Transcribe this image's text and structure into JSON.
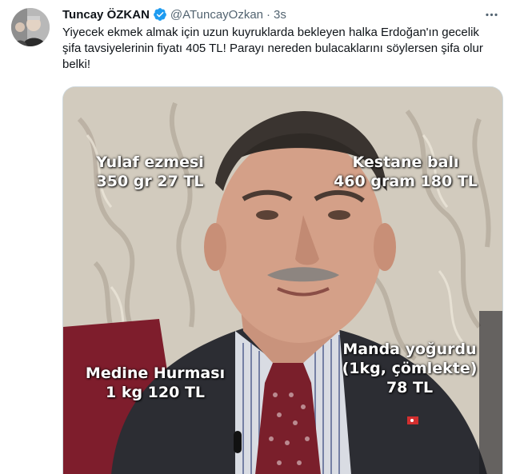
{
  "tweet": {
    "author": {
      "display_name": "Tuncay ÖZKAN",
      "handle": "@ATuncayOzkan",
      "verified": true,
      "avatar_icon": "profile-photo"
    },
    "time": "3s",
    "separator": "·",
    "more_icon": "more-horizontal-icon",
    "text": "Yiyecek ekmek almak için uzun kuyruklarda bekleyen halka Erdoğan'ın gecelik şifa tavsiyelerinin fiyatı 405 TL! Parayı nereden bulacaklarını söylersen şifa olur belki!",
    "media": {
      "captions": {
        "yulaf_line1": "Yulaf ezmesi",
        "yulaf_line2": "350 gr 27 TL",
        "kestane_line1": "Kestane balı",
        "kestane_line2": "460 gram 180 TL",
        "manda_line1": "Manda yoğurdu",
        "manda_line2": "(1kg, çömlekte)",
        "manda_line3": "78 TL",
        "medine_line1": "Medine Hurması",
        "medine_line2": "1 kg 120 TL"
      }
    }
  },
  "colors": {
    "verified_blue": "#1d9bf0",
    "secondary_text": "#536471",
    "primary_text": "#0f1419",
    "caption_text": "#ffffff"
  }
}
